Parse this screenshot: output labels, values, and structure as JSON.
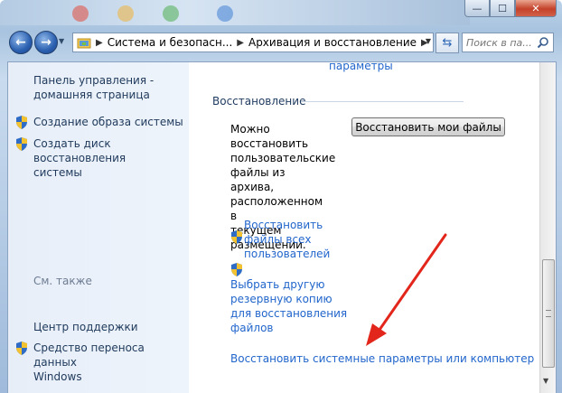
{
  "window": {
    "caption_buttons": {
      "minimize": "—",
      "maximize": "☐",
      "close": "✕"
    }
  },
  "navbar": {
    "back_icon": "back-arrow-icon",
    "forward_icon": "forward-arrow-icon",
    "breadcrumbs": [
      "Система и безопасн...",
      "Архивация и восстановление"
    ],
    "search_placeholder": "Поиск в па..."
  },
  "left_pane": {
    "home_link_line1": "Панель управления -",
    "home_link_line2": "домашняя страница",
    "tasks": [
      {
        "label": "Создание образа системы",
        "icon": "uac-shield-icon"
      },
      {
        "label_line1": "Создать диск восстановления",
        "label_line2": "системы",
        "icon": "uac-shield-icon"
      }
    ],
    "see_also_title": "См. также",
    "see_also": [
      {
        "label": "Центр поддержки"
      },
      {
        "label_line1": "Средство переноса данных",
        "label_line2": "Windows",
        "icon": "uac-shield-icon"
      }
    ]
  },
  "main_pane": {
    "top_link": "параметры",
    "section_title": "Восстановление",
    "description": [
      "Можно",
      "восстановить",
      "пользовательские",
      "файлы из архива,",
      "расположенном в",
      "текущем",
      "размещении."
    ],
    "restore_button": "Восстановить мои файлы",
    "links": [
      {
        "lines": [
          "Восстановить",
          "файлы всех",
          "пользователей"
        ],
        "icon": "uac-shield-icon"
      },
      {
        "lines": [
          "Выбрать другую",
          "резервную копию",
          "для восстановления",
          "файлов"
        ],
        "icon": "uac-shield-icon"
      },
      {
        "lines": [
          "Восстановить системные параметры или компьютер"
        ]
      }
    ]
  },
  "annotation": {
    "color": "#e3261c"
  }
}
